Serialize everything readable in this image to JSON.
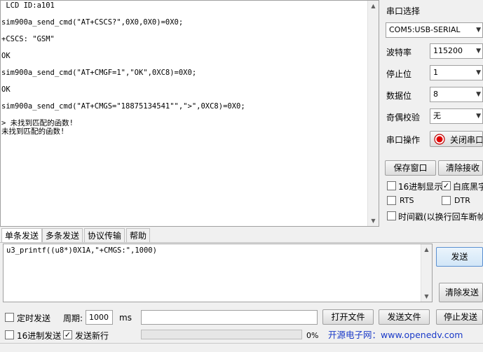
{
  "receive": {
    "lines": [
      " LCD ID:a101",
      "",
      "sim900a_send_cmd(\"AT+CSCS?\",0X0,0X0)=0X0;",
      "",
      "+CSCS: \"GSM\"",
      "",
      "OK",
      "",
      "sim900a_send_cmd(\"AT+CMGF=1\",\"OK\",0XC8)=0X0;",
      "",
      "OK",
      "",
      "sim900a_send_cmd(\"AT+CMGS=\"18875134541\"\",\">\",0XC8)=0X0;",
      "",
      "> 未找到匹配的函数!",
      "未找到匹配的函数!"
    ]
  },
  "panel": {
    "port_select_label": "串口选择",
    "port_value": "COM5:USB-SERIAL",
    "baud_label": "波特率",
    "baud_value": "115200",
    "stopbit_label": "停止位",
    "stopbit_value": "1",
    "databit_label": "数据位",
    "databit_value": "8",
    "parity_label": "奇偶校验",
    "parity_value": "无",
    "port_op_label": "串口操作",
    "close_port_label": "关闭串口",
    "save_window_label": "保存窗口",
    "clear_recv_label": "清除接收",
    "hex_display_label": "16进制显示",
    "hex_display_checked": false,
    "white_bg_label": "白底黑字",
    "white_bg_checked": true,
    "rts_label": "RTS",
    "rts_checked": false,
    "dtr_label": "DTR",
    "dtr_checked": false,
    "timestamp_label": "时间戳(以换行回车断帧)",
    "timestamp_checked": false
  },
  "tabs": [
    "单条发送",
    "多条发送",
    "协议传输",
    "帮助"
  ],
  "send": {
    "text": "u3_printf((u8*)0X1A,\"+CMGS:\",1000)",
    "send_button": "发送",
    "clear_send_button": "清除发送"
  },
  "bottom": {
    "timed_send_label": "定时发送",
    "timed_send_checked": false,
    "period_label": "周期:",
    "period_value": "1000",
    "period_unit": "ms",
    "open_file_button": "打开文件",
    "send_file_button": "发送文件",
    "stop_send_button": "停止发送",
    "hex_send_label": "16进制发送",
    "hex_send_checked": false,
    "send_newline_label": "发送新行",
    "send_newline_checked": true,
    "progress_text": "0%",
    "progress_value": 0,
    "brand_text": "开源电子网：www.openedv.com"
  }
}
